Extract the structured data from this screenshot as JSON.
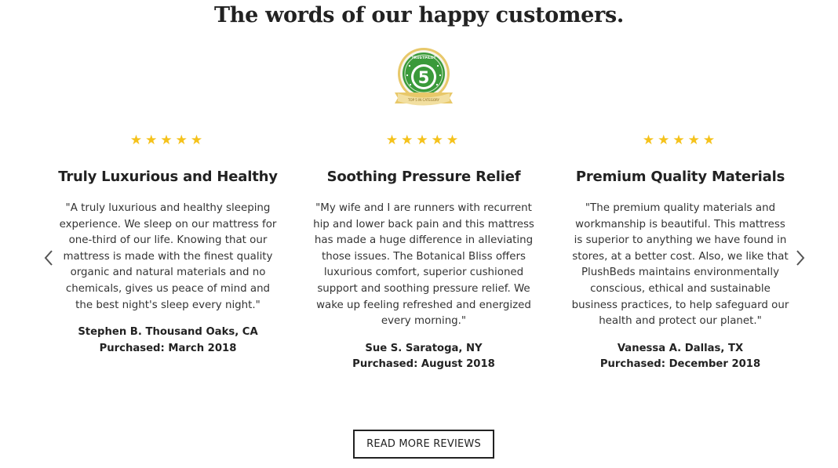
{
  "heading": "The words of our happy customers.",
  "badge": {
    "top_text": "TRUSTPILOT",
    "number": "5",
    "ribbon_text": "TOP 5 IN CATEGORY",
    "colors": {
      "green": "#3a9a3a",
      "gold": "#e8c86a",
      "ribbon": "#f2dfa0"
    }
  },
  "stars_color": "#f5c21b",
  "reviews": [
    {
      "rating": 5,
      "title": "Truly Luxurious and Healthy",
      "quote": "\"A truly luxurious and healthy sleeping experience. We sleep on our mattress for one-third of our life. Knowing that our mattress is made with the finest quality organic and natural materials and no chemicals, gives us peace of mind and the best night's sleep every night.\"",
      "author": "Stephen B. Thousand Oaks, CA",
      "purchased": "Purchased: March 2018"
    },
    {
      "rating": 5,
      "title": "Soothing Pressure Relief",
      "quote": "\"My wife and I are runners with recurrent hip and lower back pain and this mattress has made a huge difference in alleviating those issues. The Botanical Bliss offers luxurious comfort, superior cushioned support and soothing pressure relief. We wake up feeling refreshed and energized every morning.\"",
      "author": "Sue S. Saratoga, NY",
      "purchased": "Purchased: August 2018"
    },
    {
      "rating": 5,
      "title": "Premium Quality Materials",
      "quote": "\"The premium quality materials and workmanship is beautiful. This mattress is superior to anything we have found in stores, at a better cost. Also, we like that PlushBeds maintains environmentally conscious, ethical and sustainable business practices, to help safeguard our health and protect our planet.\"",
      "author": "Vanessa A. Dallas, TX",
      "purchased": "Purchased: December 2018"
    }
  ],
  "nav": {
    "prev_icon": "chevron-left-icon",
    "next_icon": "chevron-right-icon"
  },
  "read_more_label": "READ MORE REVIEWS"
}
